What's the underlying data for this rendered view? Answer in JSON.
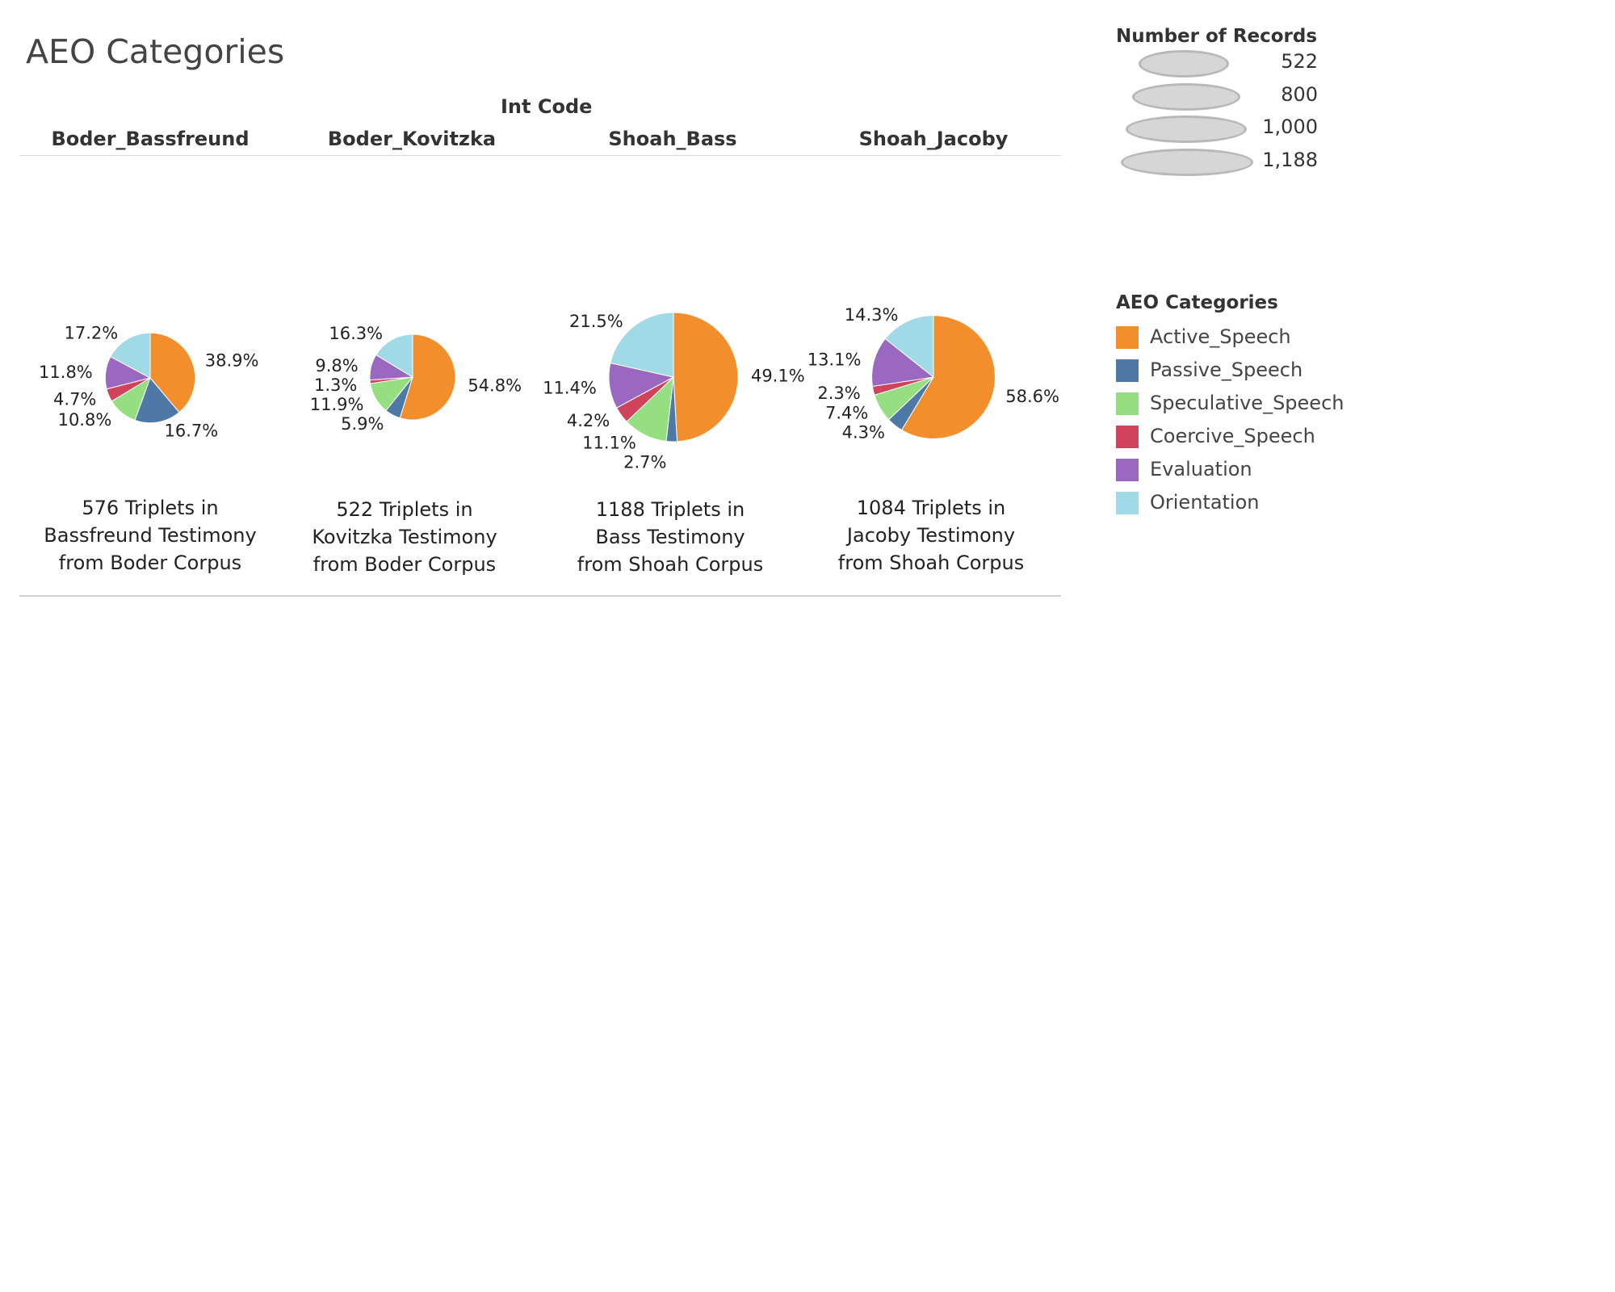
{
  "title": "AEO Categories",
  "column_group_label": "Int Code",
  "columns": [
    "Boder_Bassfreund",
    "Boder_Kovitzka",
    "Shoah_Bass",
    "Shoah_Jacoby"
  ],
  "captions": [
    [
      "576 Triplets in",
      "Bassfreund Testimony",
      "from Boder Corpus"
    ],
    [
      "522 Triplets in",
      "Kovitzka Testimony",
      "from Boder Corpus"
    ],
    [
      "1188 Triplets in",
      "Bass Testimony",
      "from Shoah Corpus"
    ],
    [
      "1084 Triplets in",
      "Jacoby Testimony",
      "from Shoah Corpus"
    ]
  ],
  "size_legend": {
    "title": "Number of Records",
    "values": [
      "522",
      "800",
      "1,000",
      "1,188"
    ]
  },
  "color_legend": {
    "title": "AEO Categories",
    "items": [
      {
        "label": "Active_Speech",
        "color": "#f28e2b"
      },
      {
        "label": "Passive_Speech",
        "color": "#4e79a7"
      },
      {
        "label": "Speculative_Speech",
        "color": "#95df82"
      },
      {
        "label": "Coercive_Speech",
        "color": "#d1435b"
      },
      {
        "label": "Evaluation",
        "color": "#9a67c1"
      },
      {
        "label": "Orientation",
        "color": "#a0dae6"
      }
    ]
  },
  "chart_data": {
    "type": "pie",
    "categories": [
      "Active_Speech",
      "Passive_Speech",
      "Speculative_Speech",
      "Coercive_Speech",
      "Evaluation",
      "Orientation"
    ],
    "pies": [
      {
        "name": "Boder_Bassfreund",
        "records": 576,
        "values": [
          38.9,
          16.7,
          10.8,
          4.7,
          11.8,
          17.2
        ],
        "labels": [
          "38.9%",
          "16.7%",
          "10.8%",
          "4.7%",
          "11.8%",
          "17.2%"
        ]
      },
      {
        "name": "Boder_Kovitzka",
        "records": 522,
        "values": [
          54.8,
          5.9,
          11.9,
          1.3,
          9.8,
          16.3
        ],
        "labels": [
          "54.8%",
          "5.9%",
          "11.9%",
          "1.3%",
          "9.8%",
          "16.3%"
        ]
      },
      {
        "name": "Shoah_Bass",
        "records": 1188,
        "values": [
          49.1,
          2.7,
          11.1,
          4.2,
          11.4,
          21.5
        ],
        "labels": [
          "49.1%",
          "2.7%",
          "11.1%",
          "4.2%",
          "11.4%",
          "21.5%"
        ]
      },
      {
        "name": "Shoah_Jacoby",
        "records": 1084,
        "values": [
          58.6,
          4.3,
          7.4,
          2.3,
          13.1,
          14.3
        ],
        "labels": [
          "58.6%",
          "4.3%",
          "7.4%",
          "2.3%",
          "13.1%",
          "14.3%"
        ]
      }
    ]
  }
}
